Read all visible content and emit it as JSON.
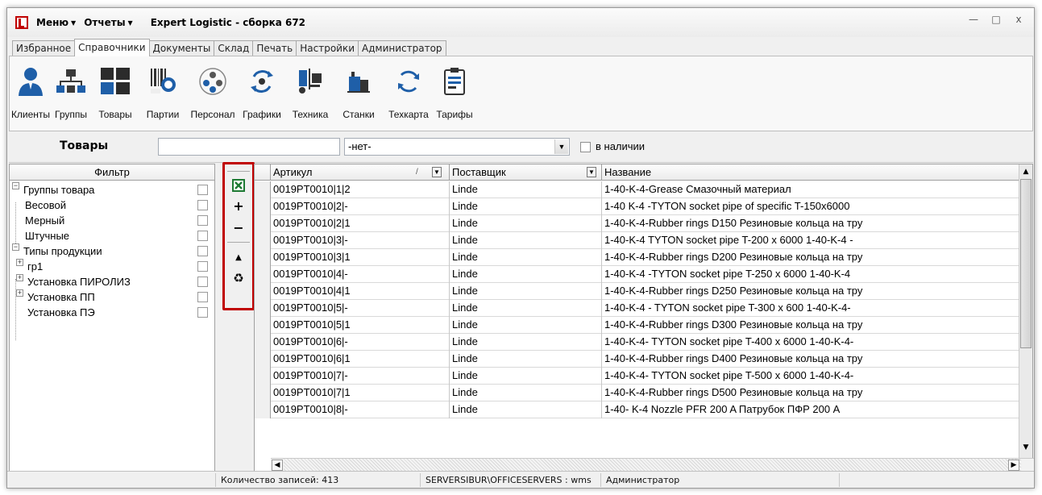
{
  "titlebar": {
    "menu_label": "Меню",
    "reports_label": "Отчеты",
    "title": "Expert Logistic - сборка 672",
    "minimize": "—",
    "maximize": "□",
    "close": "x"
  },
  "tabs": [
    {
      "label": "Избранное"
    },
    {
      "label": "Справочники",
      "active": true
    },
    {
      "label": "Документы"
    },
    {
      "label": "Склад"
    },
    {
      "label": "Печать"
    },
    {
      "label": "Настройки"
    },
    {
      "label": "Администратор"
    }
  ],
  "ribbon": [
    {
      "label": "Клиенты",
      "icon": "person-icon"
    },
    {
      "label": "Группы",
      "icon": "org-chart-icon"
    },
    {
      "label": "Товары",
      "icon": "grid-icon"
    },
    {
      "label": "Партии",
      "icon": "barcode-icon"
    },
    {
      "label": "Персонал",
      "icon": "staff-icon"
    },
    {
      "label": "Графики",
      "icon": "cycle-icon"
    },
    {
      "label": "Техника",
      "icon": "forklift-icon"
    },
    {
      "label": "Станки",
      "icon": "machine-icon"
    },
    {
      "label": "Техкарта",
      "icon": "refresh-icon"
    },
    {
      "label": "Тарифы",
      "icon": "clipboard-icon"
    }
  ],
  "search": {
    "title": "Товары",
    "input_value": "",
    "select_value": "-нет-",
    "in_stock_label": "в наличии"
  },
  "filter": {
    "header": "Фильтр",
    "items": [
      {
        "label": "Группы товара",
        "level": 0,
        "expander": "−"
      },
      {
        "label": "Весовой",
        "level": 1
      },
      {
        "label": "Мерный",
        "level": 1
      },
      {
        "label": "Штучные",
        "level": 1
      },
      {
        "label": "Типы продукции",
        "level": 0,
        "expander": "−"
      },
      {
        "label": "гр1",
        "level": 1,
        "expander": "+"
      },
      {
        "label": "Установка ПИРОЛИЗ",
        "level": 1,
        "expander": "+"
      },
      {
        "label": "Установка ПП",
        "level": 1,
        "expander": "+"
      },
      {
        "label": "Установка ПЭ",
        "level": 1
      }
    ]
  },
  "grid": {
    "columns": {
      "article": "Артикул",
      "supplier": "Поставщик",
      "name": "Название"
    },
    "rows": [
      {
        "article": "0019PT0010|1|2",
        "supplier": "Linde",
        "name": "1-40-K-4-Grease Смазочный материал"
      },
      {
        "article": "0019PT0010|2|-",
        "supplier": "Linde",
        "name": "1-40 K-4 -TYTON socket pipe of specific T-150x6000"
      },
      {
        "article": "0019PT0010|2|1",
        "supplier": "Linde",
        "name": "1-40-K-4-Rubber rings D150 Резиновые кольца на тру"
      },
      {
        "article": "0019PT0010|3|-",
        "supplier": "Linde",
        "name": "1-40-K-4 TYTON socket pipe T-200 x 6000 1-40-K-4 -"
      },
      {
        "article": "0019PT0010|3|1",
        "supplier": "Linde",
        "name": "1-40-K-4-Rubber rings D200 Резиновые кольца на тру"
      },
      {
        "article": "0019PT0010|4|-",
        "supplier": "Linde",
        "name": "1-40-K-4 -TYTON socket pipe T-250 x 6000 1-40-K-4"
      },
      {
        "article": "0019PT0010|4|1",
        "supplier": "Linde",
        "name": "1-40-K-4-Rubber rings D250 Резиновые кольца на тру"
      },
      {
        "article": "0019PT0010|5|-",
        "supplier": "Linde",
        "name": "1-40-K-4 - TYTON socket pipe T-300 x 600 1-40-K-4-"
      },
      {
        "article": "0019PT0010|5|1",
        "supplier": "Linde",
        "name": "1-40-K-4-Rubber rings D300 Резиновые кольца на тру"
      },
      {
        "article": "0019PT0010|6|-",
        "supplier": "Linde",
        "name": "1-40-K-4- TYTON socket pipe T-400 x 6000 1-40-K-4-"
      },
      {
        "article": "0019PT0010|6|1",
        "supplier": "Linde",
        "name": "1-40-K-4-Rubber rings D400 Резиновые кольца на тру"
      },
      {
        "article": "0019PT0010|7|-",
        "supplier": "Linde",
        "name": "1-40-K-4- TYTON socket pipe T-500 x 6000 1-40-K-4-"
      },
      {
        "article": "0019PT0010|7|1",
        "supplier": "Linde",
        "name": "1-40-K-4-Rubber rings D500 Резиновые кольца на тру"
      },
      {
        "article": "0019PT0010|8|-",
        "supplier": "Linde",
        "name": "1-40- K-4 Nozzle PFR 200 A Патрубок ПФР 200 А"
      }
    ]
  },
  "sidetoolbar": {
    "accent": "#c00000",
    "buttons": [
      {
        "icon": "excel-export-icon"
      },
      {
        "icon": "plus-icon",
        "glyph": "+"
      },
      {
        "icon": "minus-icon",
        "glyph": "−"
      },
      {
        "icon": "arrow-up-icon",
        "glyph": "▲"
      },
      {
        "icon": "recycle-icon",
        "glyph": "♻"
      }
    ]
  },
  "status": {
    "records": "Количество записей: 413",
    "server": "SERVERSIBUR\\OFFICESERVERS : wms",
    "user": "Администратор"
  }
}
